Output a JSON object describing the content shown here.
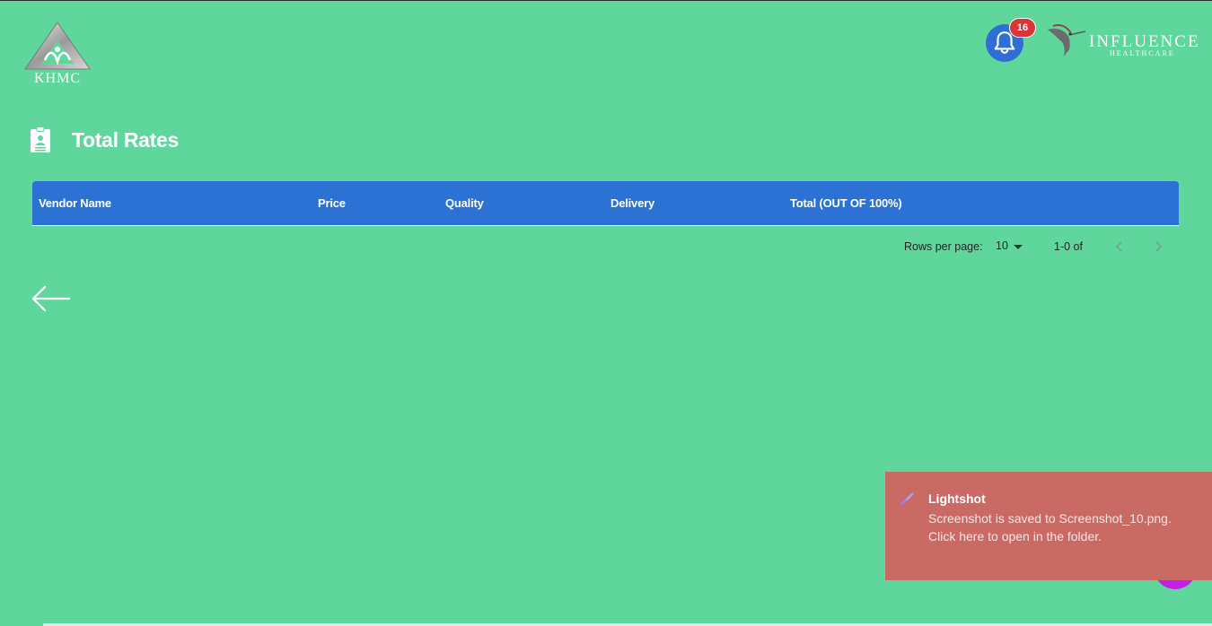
{
  "header": {
    "left_logo_text": "KHMC",
    "notification_count": "16",
    "right_logo_title": "INFLUENCE",
    "right_logo_subtitle": "HEALTHCARE"
  },
  "page": {
    "title": "Total Rates",
    "title_icon": "clipboard-user-icon"
  },
  "table": {
    "columns": [
      "Vendor Name",
      "Price",
      "Quality",
      "Delivery",
      "Total (OUT OF 100%)"
    ],
    "rows": []
  },
  "pagination": {
    "rows_per_page_label": "Rows per page:",
    "rows_per_page_value": "10",
    "range_text": "1-0 of"
  },
  "navigation": {
    "back_icon": "arrow-left-icon"
  },
  "toast": {
    "app": "Lightshot",
    "message": "Screenshot is saved to Screenshot_10.png. Click here to open in the folder."
  },
  "colors": {
    "background": "#5fd69c",
    "table_header": "#2b72d4",
    "bell_button": "#2d6fd4",
    "badge": "#d63638",
    "toast": "#c96b64",
    "fab": "#c41fe6"
  }
}
